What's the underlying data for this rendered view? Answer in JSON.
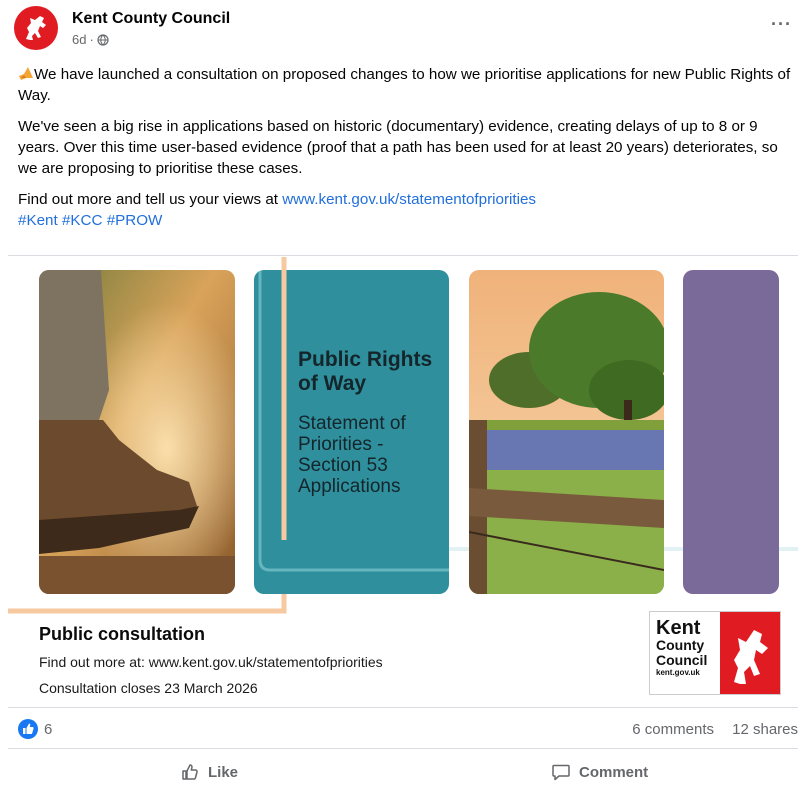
{
  "post": {
    "page_name": "Kent County Council",
    "time": "6d",
    "audience_icon": "globe-icon",
    "more_icon": "more-options-icon",
    "more_glyph": "···",
    "text": {
      "para1": "We have launched a consultation on proposed changes to how we prioritise applications for new Public Rights of Way.",
      "para2": "We've seen a big rise in applications based on historic (documentary) evidence, creating delays of up to 8 or 9 years. Over this time user-based evidence (proof that a path has been used for at least 20 years) deteriorates, so we are proposing to prioritise these cases.",
      "para3_prefix": "Find out more and tell us your views at ",
      "link": "www.kent.gov.uk/statementofpriorities",
      "hashtags": [
        "#Kent",
        "#KCC",
        "#PROW"
      ]
    }
  },
  "media": {
    "teal_title": "Public Rights of Way",
    "teal_subtitle": "Statement of Priorities - Section 53 Applications",
    "consultation_title": "Public consultation",
    "consultation_line1": "Find out more at: www.kent.gov.uk/statementofpriorities",
    "consultation_line2": "Consultation closes 23 March 2026",
    "logo": {
      "word1": "Kent",
      "word2": "County",
      "word3": "Council",
      "url": "kent.gov.uk"
    }
  },
  "stats": {
    "likes": "6",
    "comments": "6 comments",
    "shares": "12 shares"
  },
  "actions": {
    "like": "Like",
    "comment": "Comment"
  },
  "colors": {
    "accent": "#1877f2",
    "link": "#216fdb",
    "brand_red": "#e11b22",
    "teal_tile": "#2f8f9d",
    "purple_tile": "#7a6a9a",
    "orange_line": "#f6c9a0"
  }
}
